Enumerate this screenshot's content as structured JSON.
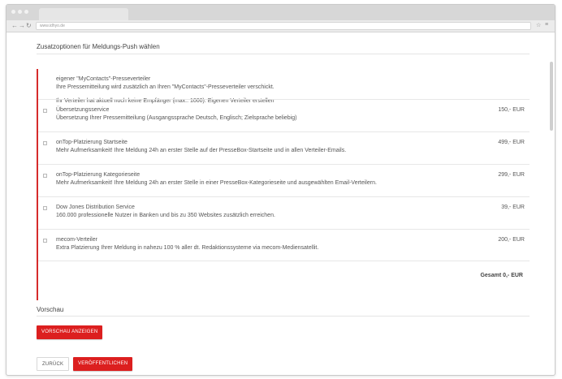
{
  "browser": {
    "tab_title": "",
    "url": "www.idhyo.de"
  },
  "page": {
    "section_title": "Zusatzoptionen für Meldungs-Push wählen",
    "intro": {
      "title": "eigener \"MyContacts\"-Presseverteiler",
      "text": "Ihre Pressemitteilung wird zusätzlich an Ihren \"MyContacts\"-Presseverteiler verschickt.",
      "note": "Ihr Verteiler hat aktuell noch keine Empfänger (max.: 1000): Eigenen Verteiler erstellen"
    },
    "options": [
      {
        "title": "Übersetzungsservice",
        "desc": "Übersetzung Ihrer Pressemitteilung (Ausgangssprache Deutsch, Englisch; Zielsprache beliebig)",
        "price": "150,- EUR"
      },
      {
        "title": "onTop-Platzierung Startseite",
        "desc": "Mehr Aufmerksamkeit! Ihre Meldung 24h an erster Stelle auf der PresseBox-Startseite und in allen Verteiler-Emails.",
        "price": "499,- EUR"
      },
      {
        "title": "onTop-Platzierung Kategorieseite",
        "desc": "Mehr Aufmerksamkeit! Ihre Meldung 24h an erster Stelle in einer PresseBox-Kategorieseite und ausgewählten Email-Verteilern.",
        "price": "299,- EUR"
      },
      {
        "title": "Dow Jones Distribution Service",
        "desc": "160.000 professionelle Nutzer in Banken und bis zu 350 Websites zusätzlich erreichen.",
        "price": "39,- EUR"
      },
      {
        "title": "mecom-Verteiler",
        "desc": "Extra Platzierung Ihrer Meldung in nahezu 100 % aller dt. Redaktionssysteme via mecom-Mediensatellit.",
        "price": "200,- EUR"
      }
    ],
    "total": "Gesamt 0,- EUR",
    "preview": {
      "title": "Vorschau",
      "button": "Vorschau anzeigen"
    },
    "actions": {
      "back": "Zurück",
      "publish": "Veröffentlichen"
    }
  },
  "colors": {
    "accent": "#dc1f1f",
    "panel_border": "#d62b2b"
  }
}
